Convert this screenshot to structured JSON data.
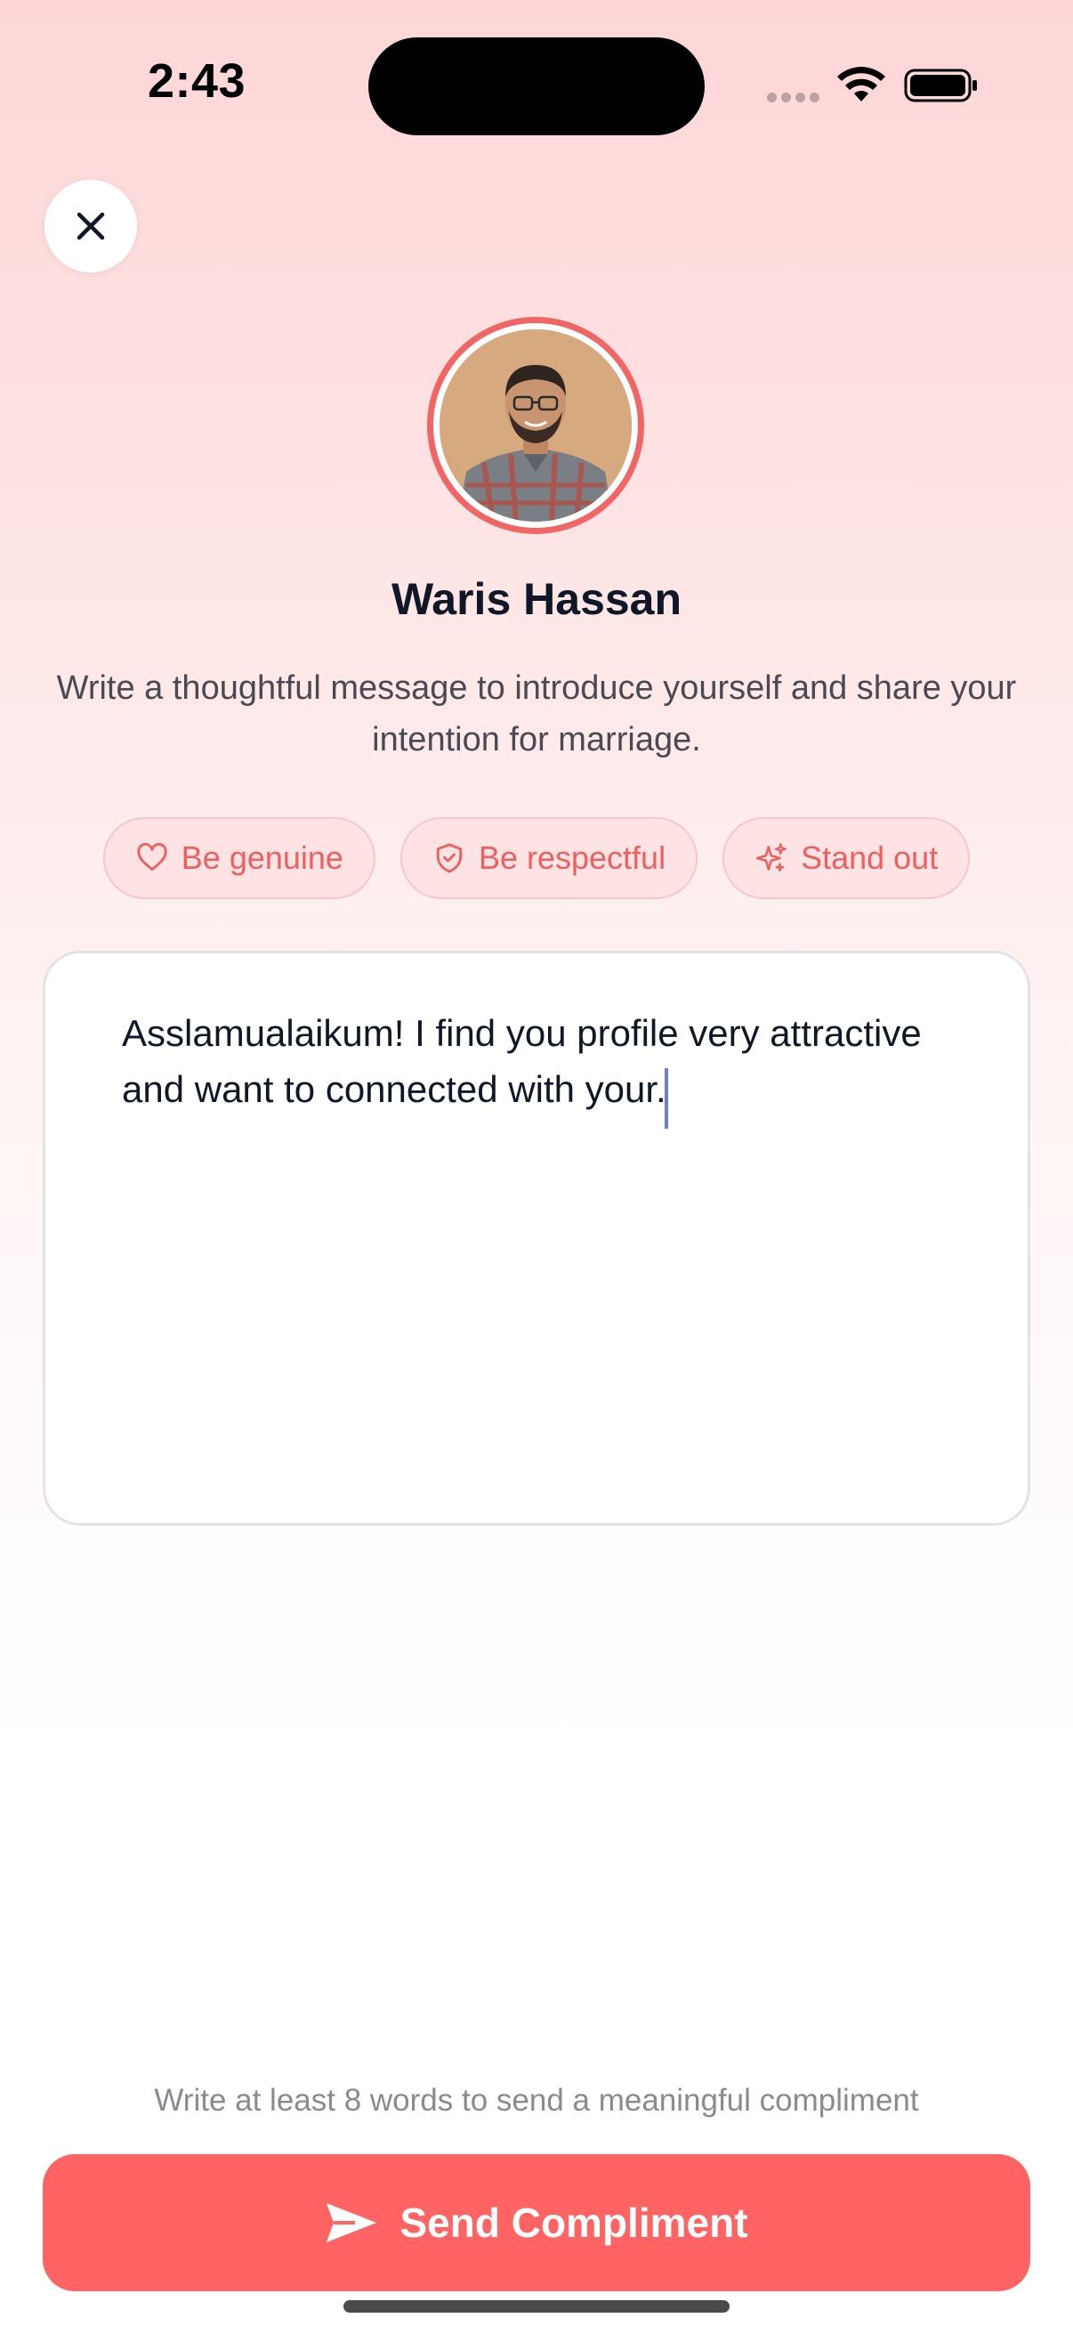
{
  "status_bar": {
    "time": "2:43"
  },
  "profile": {
    "name": "Waris Hassan",
    "avatar_icon": "person-photo"
  },
  "intro": {
    "text": "Write a thoughtful message to introduce yourself and share your intention for marriage."
  },
  "tips": [
    {
      "label": "Be genuine",
      "icon": "heart-icon"
    },
    {
      "label": "Be respectful",
      "icon": "shield-check-icon"
    },
    {
      "label": "Stand out",
      "icon": "sparkles-icon"
    }
  ],
  "message": {
    "value": "Asslamualaikum! I find you profile very attractive and want to connected with your."
  },
  "hint": {
    "text": "Write at least 8 words to send a meaningful compliment"
  },
  "send_button": {
    "label": "Send Compliment",
    "icon": "send-icon"
  },
  "colors": {
    "accent": "#ff6363",
    "chip_text": "#ef5f5f",
    "chip_bg": "#fde3e3"
  }
}
